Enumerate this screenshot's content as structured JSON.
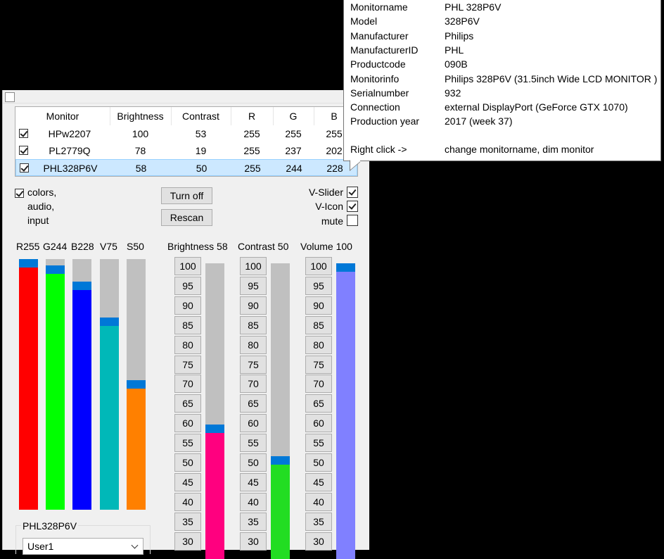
{
  "table": {
    "headers": [
      "Monitor",
      "Brightness",
      "Contrast",
      "R",
      "G",
      "B"
    ],
    "rows": [
      {
        "checked": true,
        "name": "HPw2207",
        "brightness": "100",
        "contrast": "53",
        "r": "255",
        "g": "255",
        "b": "255",
        "selected": false
      },
      {
        "checked": true,
        "name": "PL2779Q",
        "brightness": "78",
        "contrast": "19",
        "r": "255",
        "g": "237",
        "b": "202",
        "selected": false
      },
      {
        "checked": true,
        "name": "PHL328P6V",
        "brightness": "58",
        "contrast": "50",
        "r": "255",
        "g": "244",
        "b": "228",
        "selected": true
      }
    ]
  },
  "options": {
    "colors_label_lines": [
      "colors,",
      "audio,",
      "input"
    ],
    "colors_checked": true,
    "turn_off_label": "Turn off",
    "rescan_label": "Rescan",
    "vslider_label": "V-Slider",
    "vslider_checked": true,
    "vicon_label": "V-Icon",
    "vicon_checked": true,
    "mute_label": "mute",
    "mute_checked": false
  },
  "color_sliders": [
    {
      "label": "R255",
      "value": 255,
      "max": 255,
      "color": "#ff0000"
    },
    {
      "label": "G244",
      "value": 244,
      "max": 255,
      "color": "#00ff00"
    },
    {
      "label": "B228",
      "value": 228,
      "max": 255,
      "color": "#0000ff"
    },
    {
      "label": "V75",
      "value": 75,
      "max": 100,
      "color": "#00b8b8"
    },
    {
      "label": "S50",
      "value": 50,
      "max": 100,
      "color": "#ff8000"
    }
  ],
  "big_sliders": [
    {
      "label": "Brightness 58",
      "value": 58,
      "color": "#ff007f"
    },
    {
      "label": "Contrast 50",
      "value": 50,
      "color": "#22dd22"
    },
    {
      "label": "Volume 100",
      "value": 100,
      "color": "#8080ff"
    }
  ],
  "scale_values": [
    "100",
    "95",
    "90",
    "85",
    "80",
    "75",
    "70",
    "65",
    "60",
    "55",
    "50",
    "45",
    "40",
    "35",
    "30"
  ],
  "profile": {
    "group_title": "PHL328P6V",
    "selected": "User1"
  },
  "tooltip": {
    "rows": [
      {
        "k": "Monitorname",
        "v": "PHL 328P6V"
      },
      {
        "k": "Model",
        "v": "328P6V"
      },
      {
        "k": "Manufacturer",
        "v": "Philips"
      },
      {
        "k": "ManufacturerID",
        "v": "PHL"
      },
      {
        "k": "Productcode",
        "v": "090B"
      },
      {
        "k": "Monitorinfo",
        "v": "Philips 328P6V (31.5inch Wide LCD MONITOR )"
      },
      {
        "k": "Serialnumber",
        "v": "932"
      },
      {
        "k": "Connection",
        "v": "external DisplayPort (GeForce GTX 1070)"
      },
      {
        "k": "Production year",
        "v": "2017 (week 37)"
      }
    ],
    "hint_key": "Right click  ->",
    "hint_value": "change monitorname, dim monitor"
  }
}
